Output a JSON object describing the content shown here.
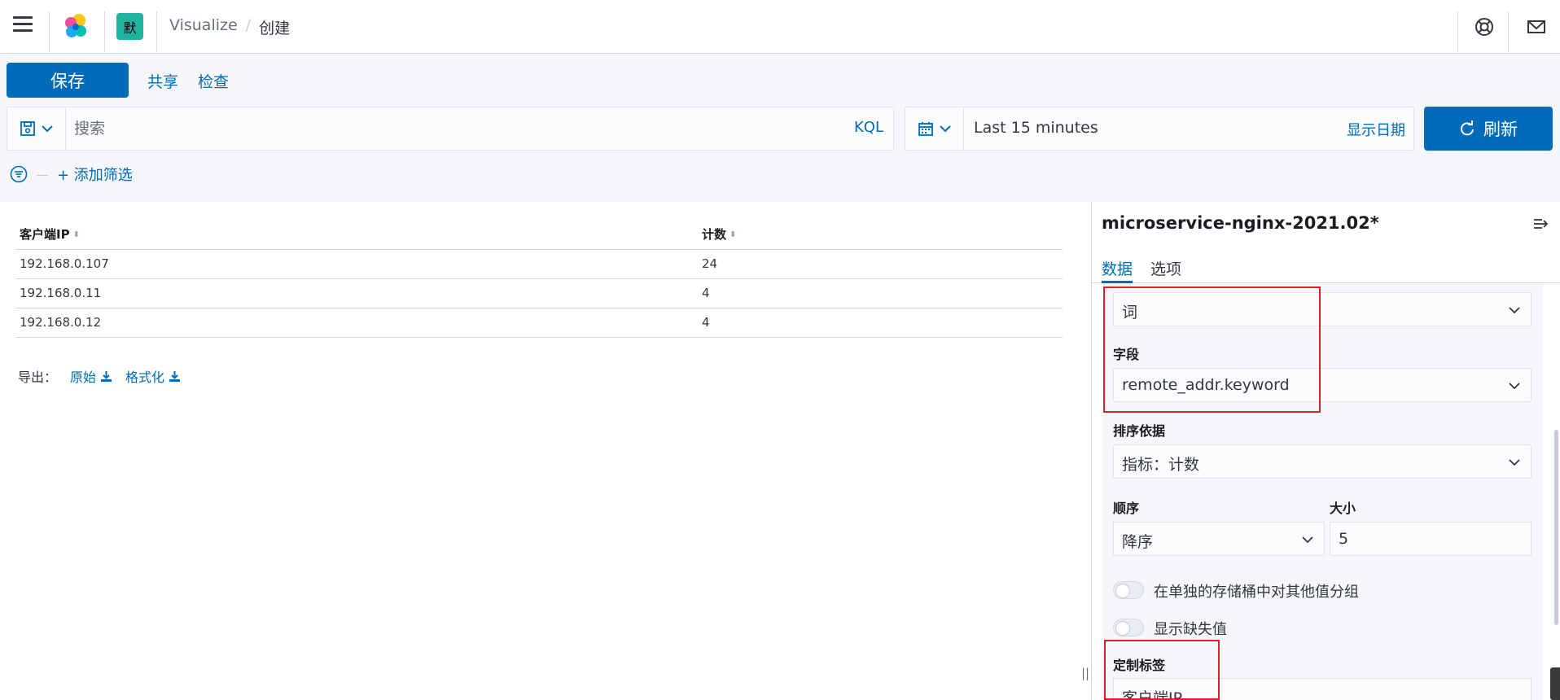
{
  "header": {
    "space_initial": "默",
    "breadcrumbs": [
      "Visualize",
      "创建"
    ],
    "breadcrumb_separator": "/"
  },
  "toolbar": {
    "save_label": "保存",
    "share_label": "共享",
    "inspect_label": "检查"
  },
  "query": {
    "placeholder": "搜索",
    "language": "KQL"
  },
  "date": {
    "range": "Last 15 minutes",
    "show_dates": "显示日期",
    "refresh_label": "刷新"
  },
  "filters": {
    "add_label": "+ 添加筛选"
  },
  "table": {
    "columns": [
      "客户端IP",
      "计数"
    ],
    "rows": [
      [
        "192.168.0.107",
        "24"
      ],
      [
        "192.168.0.11",
        "4"
      ],
      [
        "192.168.0.12",
        "4"
      ]
    ]
  },
  "export": {
    "label": "导出：",
    "raw": "原始",
    "formatted": "格式化"
  },
  "sidebar": {
    "title": "microservice-nginx-2021.02*",
    "tabs": [
      "数据",
      "选项"
    ],
    "aggregation_value": "词",
    "field_label": "字段",
    "field_value": "remote_addr.keyword",
    "order_by_label": "排序依据",
    "order_by_value": "指标：计数",
    "order_label": "顺序",
    "order_value": "降序",
    "size_label": "大小",
    "size_value": "5",
    "toggle_other_label": "在单独的存储桶中对其他值分组",
    "toggle_missing_label": "显示缺失值",
    "custom_label_label": "定制标签",
    "custom_label_value": "客户端IP"
  },
  "colors": {
    "primary": "#006bb8",
    "highlight_box": "#e11d2a",
    "space_badge": "#20b2a0"
  }
}
